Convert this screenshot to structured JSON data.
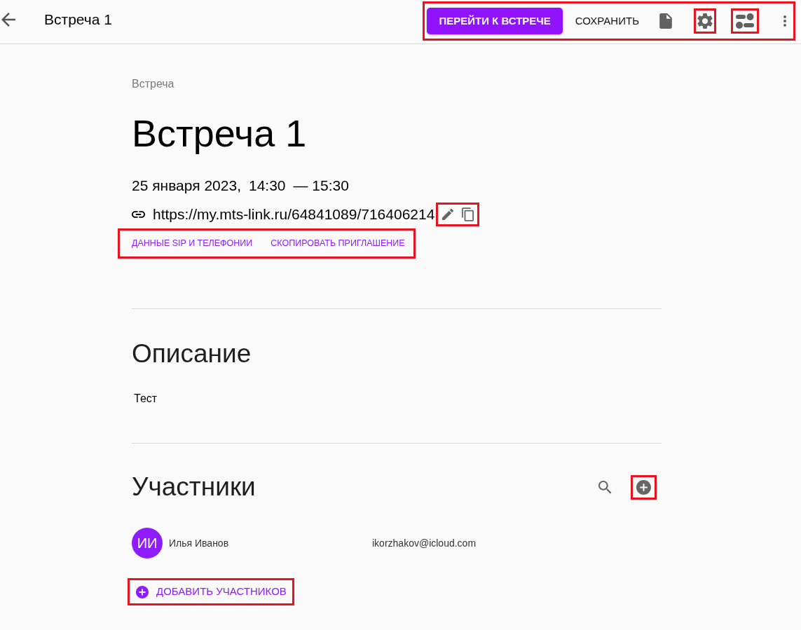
{
  "header": {
    "title": "Встреча 1"
  },
  "toolbar": {
    "highlighted": true,
    "primary_button": {
      "label": "ПЕРЕЙТИ К ВСТРЕЧЕ"
    },
    "save_button": {
      "label": "СОХРАНИТЬ"
    },
    "settings_button": {
      "highlighted": true
    },
    "layout_button": {
      "highlighted": true
    }
  },
  "meeting": {
    "breadcrumb": "Встреча",
    "title": "Встреча 1",
    "date": "25 января 2023,",
    "start_time": "14:30",
    "end_time": "— 15:30"
  },
  "link": {
    "url": "https://my.mts-link.ru/64841089/716406214",
    "actions_highlighted": true
  },
  "actions": {
    "highlighted": true,
    "links": [
      "ДАННЫЕ SIP И ТЕЛЕФОНИИ",
      "СКОПИРОВАТЬ ПРИГЛАШЕНИЕ"
    ]
  },
  "description": {
    "heading": "Описание",
    "text": "Тест"
  },
  "participants": {
    "heading": "Участники",
    "add_icon_highlighted": true,
    "people": [
      {
        "initials": "ИИ",
        "name": "Илья Иванов",
        "email": "ikorzhakov@icloud.com"
      }
    ],
    "add_button": {
      "label": "ДОБАВИТЬ УЧАСТНИКОВ",
      "highlighted": true
    }
  }
}
